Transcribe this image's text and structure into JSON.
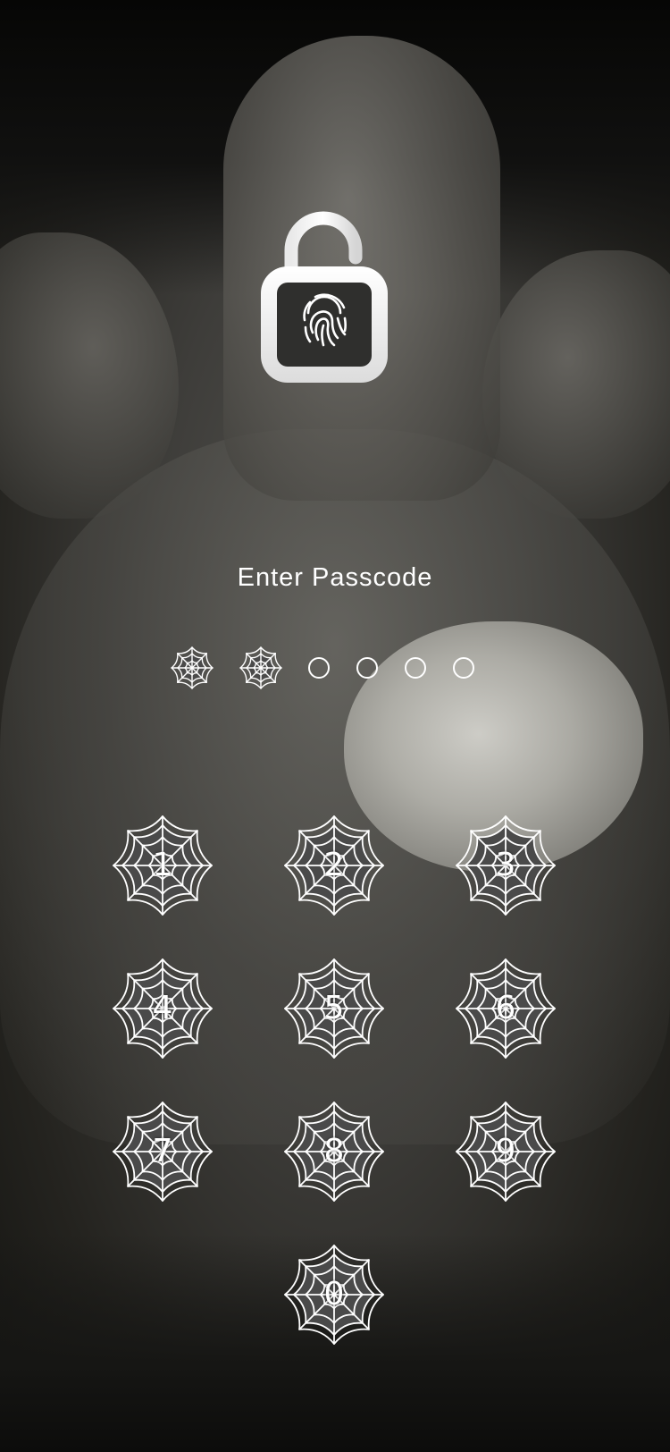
{
  "screen": {
    "title": "Enter Passcode"
  },
  "lock": {
    "icon": "fingerprint-lock-icon"
  },
  "passcode": {
    "length": 6,
    "filled": 2
  },
  "keypad": {
    "keys": [
      "1",
      "2",
      "3",
      "4",
      "5",
      "6",
      "7",
      "8",
      "9",
      "0"
    ]
  },
  "colors": {
    "text": "#ffffff",
    "key_fill": "#4a4a4a",
    "web_stroke": "#ffffff"
  }
}
